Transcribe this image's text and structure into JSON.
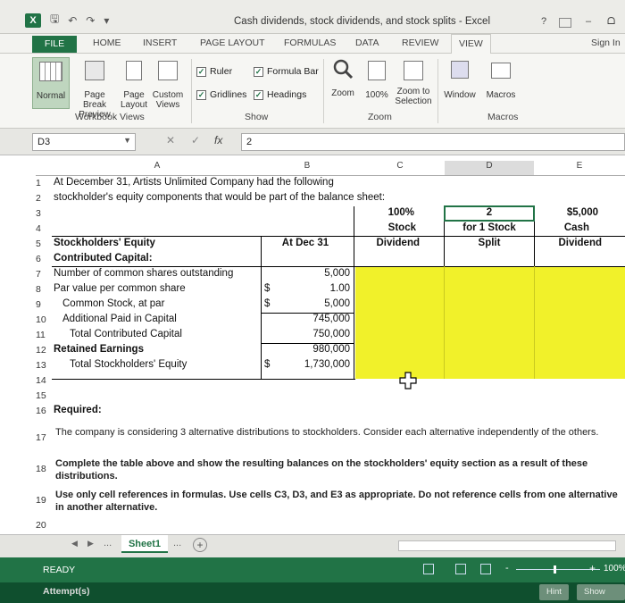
{
  "window": {
    "title": "Cash dividends, stock dividends, and stock splits - Excel",
    "help": "?",
    "minimize": "–",
    "restore": "ᗝ"
  },
  "ribbon_tabs": {
    "file": "FILE",
    "home": "HOME",
    "insert": "INSERT",
    "page_layout": "PAGE LAYOUT",
    "formulas": "FORMULAS",
    "data": "DATA",
    "review": "REVIEW",
    "view": "VIEW",
    "sign_in": "Sign In"
  },
  "ribbon": {
    "normal": "Normal",
    "page_break_1": "Page Break",
    "page_break_2": "Preview",
    "page_layout_1": "Page",
    "page_layout_2": "Layout",
    "custom_1": "Custom",
    "custom_2": "Views",
    "workbook_views": "Workbook Views",
    "ruler": "Ruler",
    "formula_bar": "Formula Bar",
    "gridlines": "Gridlines",
    "headings": "Headings",
    "show": "Show",
    "zoom": "Zoom",
    "zoom_100": "100%",
    "zoom_sel_1": "Zoom to",
    "zoom_sel_2": "Selection",
    "zoom_group": "Zoom",
    "window": "Window",
    "macros": "Macros",
    "macros_group": "Macros",
    "check": "✓"
  },
  "formula_bar": {
    "name_box": "D3",
    "value": "2",
    "fx": "fx",
    "cancel": "✕",
    "enter": "✓"
  },
  "columns": [
    "A",
    "B",
    "C",
    "D",
    "E"
  ],
  "rows": [
    "1",
    "2",
    "3",
    "4",
    "5",
    "6",
    "7",
    "8",
    "9",
    "10",
    "11",
    "12",
    "13",
    "14",
    "15",
    "16",
    "17",
    "18",
    "19",
    "20"
  ],
  "cells": {
    "r1": "At December 31, Artists Unlimited Company had the following",
    "r2": "stockholder's equity components that would be part of the balance sheet:",
    "c3": "100%",
    "c4": "Stock",
    "c5": "Dividend",
    "d3": "2",
    "d4": "for 1 Stock",
    "d5": "Split",
    "e3": "$5,000",
    "e4": "Cash",
    "e5": "Dividend",
    "a5": "Stockholders' Equity",
    "b5": "At Dec 31",
    "a6": "Contributed Capital:",
    "a7": "Number of common shares outstanding",
    "b7": "5,000",
    "a8": "Par value per common share",
    "b8_cur": "$",
    "b8": "1.00",
    "a9": "Common Stock, at par",
    "b9_cur": "$",
    "b9": "5,000",
    "a10": "Additional Paid in Capital",
    "b10": "745,000",
    "a11": "Total Contributed Capital",
    "b11": "750,000",
    "a12": "Retained Earnings",
    "b12": "980,000",
    "a13": "Total Stockholders' Equity",
    "b13_cur": "$",
    "b13": "1,730,000",
    "a16": "Required:",
    "a17": "The company is considering 3 alternative distributions to stockholders. Consider each alternative independently of the others.",
    "a18": "Complete the table above and show the resulting balances on the stockholders' equity section as a result of these distributions.",
    "a19": "Use only cell references in formulas. Use cells C3, D3, and E3 as appropriate. Do not reference cells from one alternative in another alternative."
  },
  "sheet_tabs": {
    "prev": "◀",
    "next": "▶",
    "ellipsis_left": "...",
    "sheet1": "Sheet1",
    "ellipsis_right": "...",
    "add": "+"
  },
  "status": {
    "ready": "READY",
    "zoom_minus": "-",
    "zoom_plus": "+",
    "zoom_level": "100%"
  },
  "bottom": {
    "attempts": "Attempt(s)",
    "hint": "Hint",
    "show_me": "Show Me"
  },
  "colors": {
    "excel_green": "#217346",
    "highlight_yellow": "#f1f12a"
  }
}
